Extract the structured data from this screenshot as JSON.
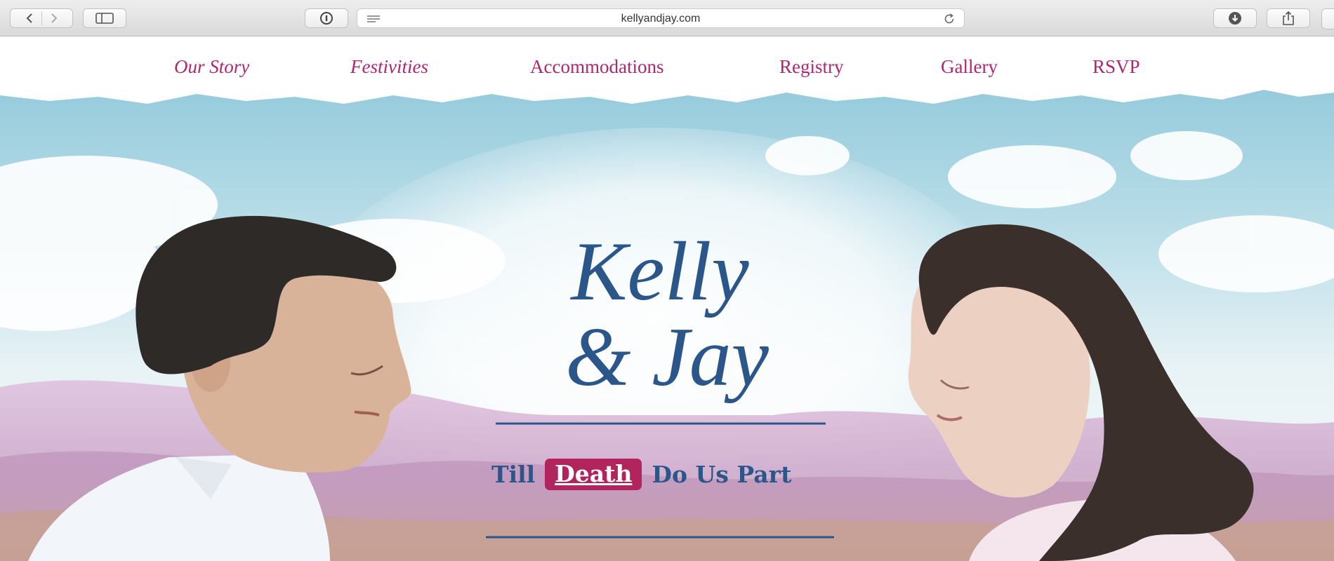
{
  "browser": {
    "url": "kellyandjay.com",
    "icons": [
      "back-icon",
      "forward-icon",
      "sidebar-icon",
      "reader-info-icon",
      "page-lines-icon",
      "reload-icon",
      "download-icon",
      "share-icon"
    ]
  },
  "nav": {
    "items": [
      {
        "label": "Our Story"
      },
      {
        "label": "Festivities"
      },
      {
        "label": "Accommodations"
      },
      {
        "label": "Registry"
      },
      {
        "label": "Gallery"
      },
      {
        "label": "RSVP"
      }
    ],
    "color": "#b0266f"
  },
  "hero": {
    "logo_line1": "Kelly",
    "logo_line2": "& Jay",
    "tagline_before": "Till",
    "tagline_highlight": "Death",
    "tagline_after": "Do Us Part",
    "colors": {
      "text_blue": "#2b5689",
      "highlight": "#b2245e",
      "sky": "#9fd0e0",
      "hills": "#c99ac4"
    }
  }
}
